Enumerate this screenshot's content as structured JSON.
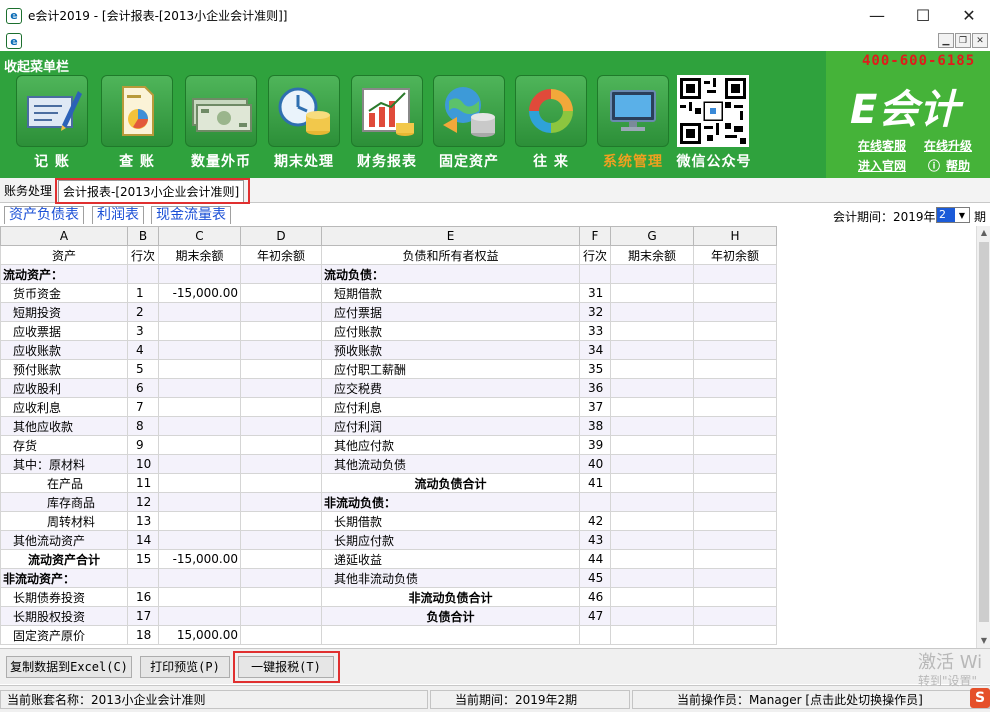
{
  "window": {
    "title": "e会计2019 - [会计报表-[2013小企业会计准则]]",
    "minimize": "—",
    "maximize": "☐",
    "close": "✕"
  },
  "banner": {
    "collapse_label": "收起菜单栏",
    "phone": "400-600-6185",
    "logo": "E会计",
    "links": [
      "在线客服",
      "在线升级",
      "进入官网",
      "帮助"
    ],
    "tools": [
      {
        "label": "记 账",
        "icon": "pen-document-icon"
      },
      {
        "label": "查 账",
        "icon": "search-document-icon"
      },
      {
        "label": "数量外币",
        "icon": "banknotes-icon"
      },
      {
        "label": "期末处理",
        "icon": "clock-coins-icon"
      },
      {
        "label": "财务报表",
        "icon": "chart-report-icon"
      },
      {
        "label": "固定资产",
        "icon": "globe-coins-icon"
      },
      {
        "label": "往 来",
        "icon": "cycle-icon"
      },
      {
        "label": "系统管理",
        "icon": "computer-icon"
      },
      {
        "label": "微信公众号",
        "icon": "qr-code-icon"
      }
    ],
    "colors": {
      "green": "#2fa23d",
      "active": "#f0a020",
      "phone": "#e01b1b"
    }
  },
  "tabs": {
    "items": [
      "账务处理",
      "会计报表-[2013小企业会计准则]"
    ]
  },
  "subtabs": {
    "items": [
      "资产负债表",
      "利润表",
      "现金流量表"
    ],
    "period_label": "会计期间：2019年",
    "period_value": "2",
    "period_suffix": "期"
  },
  "grid": {
    "column_letters": [
      "A",
      "B",
      "C",
      "D",
      "E",
      "F",
      "G",
      "H"
    ],
    "headers": [
      "资产",
      "行次",
      "期末余额",
      "年初余额",
      "负债和所有者权益",
      "行次",
      "期末余额",
      "年初余额"
    ],
    "rows": [
      [
        "流动资产：",
        "",
        "",
        "",
        "流动负债：",
        "",
        "",
        ""
      ],
      [
        "货币资金",
        "1",
        "-15,000.00",
        "",
        "短期借款",
        "31",
        "",
        ""
      ],
      [
        "短期投资",
        "2",
        "",
        "",
        "应付票据",
        "32",
        "",
        ""
      ],
      [
        "应收票据",
        "3",
        "",
        "",
        "应付账款",
        "33",
        "",
        ""
      ],
      [
        "应收账款",
        "4",
        "",
        "",
        "预收账款",
        "34",
        "",
        ""
      ],
      [
        "预付账款",
        "5",
        "",
        "",
        "应付职工薪酬",
        "35",
        "",
        ""
      ],
      [
        "应收股利",
        "6",
        "",
        "",
        "应交税费",
        "36",
        "",
        ""
      ],
      [
        "应收利息",
        "7",
        "",
        "",
        "应付利息",
        "37",
        "",
        ""
      ],
      [
        "其他应收款",
        "8",
        "",
        "",
        "应付利润",
        "38",
        "",
        ""
      ],
      [
        "存货",
        "9",
        "",
        "",
        "其他应付款",
        "39",
        "",
        ""
      ],
      [
        "其中：原材料",
        "10",
        "",
        "",
        "其他流动负债",
        "40",
        "",
        ""
      ],
      [
        "在产品",
        "11",
        "",
        "",
        "流动负债合计",
        "41",
        "",
        ""
      ],
      [
        "库存商品",
        "12",
        "",
        "",
        "非流动负债：",
        "",
        "",
        ""
      ],
      [
        "周转材料",
        "13",
        "",
        "",
        "长期借款",
        "42",
        "",
        ""
      ],
      [
        "其他流动资产",
        "14",
        "",
        "",
        "长期应付款",
        "43",
        "",
        ""
      ],
      [
        "流动资产合计",
        "15",
        "-15,000.00",
        "",
        "递延收益",
        "44",
        "",
        ""
      ],
      [
        "非流动资产：",
        "",
        "",
        "",
        "其他非流动负债",
        "45",
        "",
        ""
      ],
      [
        "长期债券投资",
        "16",
        "",
        "",
        "非流动负债合计",
        "46",
        "",
        ""
      ],
      [
        "长期股权投资",
        "17",
        "",
        "",
        "负债合计",
        "47",
        "",
        ""
      ],
      [
        "固定资产原价",
        "18",
        "15,000.00",
        "",
        "",
        "",
        "",
        ""
      ]
    ]
  },
  "buttons": {
    "copy_excel": "复制数据到Excel(C)",
    "print_preview": "打印预览(P)",
    "one_click_tax": "一键报税(T)"
  },
  "status": {
    "account_set": "当前账套名称：2013小企业会计准则",
    "period": "当前期间：2019年2期",
    "operator": "当前操作员：Manager [点击此处切换操作员]"
  },
  "watermark": {
    "line1": "激活 Wi",
    "line2": "转到\"设置\""
  }
}
